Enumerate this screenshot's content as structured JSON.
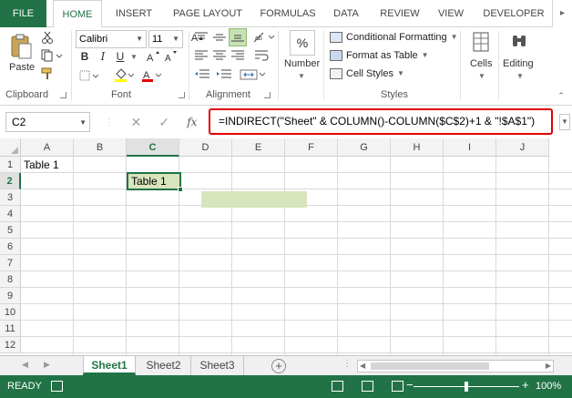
{
  "ribbon_tabs": [
    "FILE",
    "HOME",
    "INSERT",
    "PAGE LAYOUT",
    "FORMULAS",
    "DATA",
    "REVIEW",
    "VIEW",
    "DEVELOPER"
  ],
  "clipboard": {
    "paste_label": "Paste",
    "group_label": "Clipboard"
  },
  "font": {
    "name": "Calibri",
    "size": "11",
    "group_label": "Font",
    "bold": "B",
    "italic": "I",
    "underline": "U"
  },
  "alignment": {
    "group_label": "Alignment"
  },
  "number": {
    "label": "Number",
    "percent": "%"
  },
  "styles": {
    "conditional_formatting": "Conditional Formatting",
    "format_as_table": "Format as Table",
    "cell_styles": "Cell Styles",
    "group_label": "Styles"
  },
  "cells_group": {
    "label": "Cells"
  },
  "editing_group": {
    "label": "Editing"
  },
  "formula_bar": {
    "name_box": "C2",
    "fx": "fx",
    "formula": "=INDIRECT(\"Sheet\" & COLUMN()-COLUMN($C$2)+1 & \"!$A$1\")"
  },
  "columns": [
    "A",
    "B",
    "C",
    "D",
    "E",
    "F",
    "G",
    "H",
    "I",
    "J"
  ],
  "selected_column": "C",
  "rows": [
    "1",
    "2",
    "3",
    "4",
    "5",
    "6",
    "7",
    "8",
    "9",
    "10",
    "11",
    "12"
  ],
  "selected_row": "2",
  "cells": {
    "A1": "Table 1",
    "C2": "Table 1"
  },
  "sheets": [
    "Sheet1",
    "Sheet2",
    "Sheet3"
  ],
  "active_sheet": "Sheet1",
  "status": {
    "mode": "READY",
    "zoom": "100%"
  },
  "colors": {
    "excel_green": "#217346",
    "highlight_fill": "#d8e4bc",
    "formula_outline": "#e00000"
  }
}
